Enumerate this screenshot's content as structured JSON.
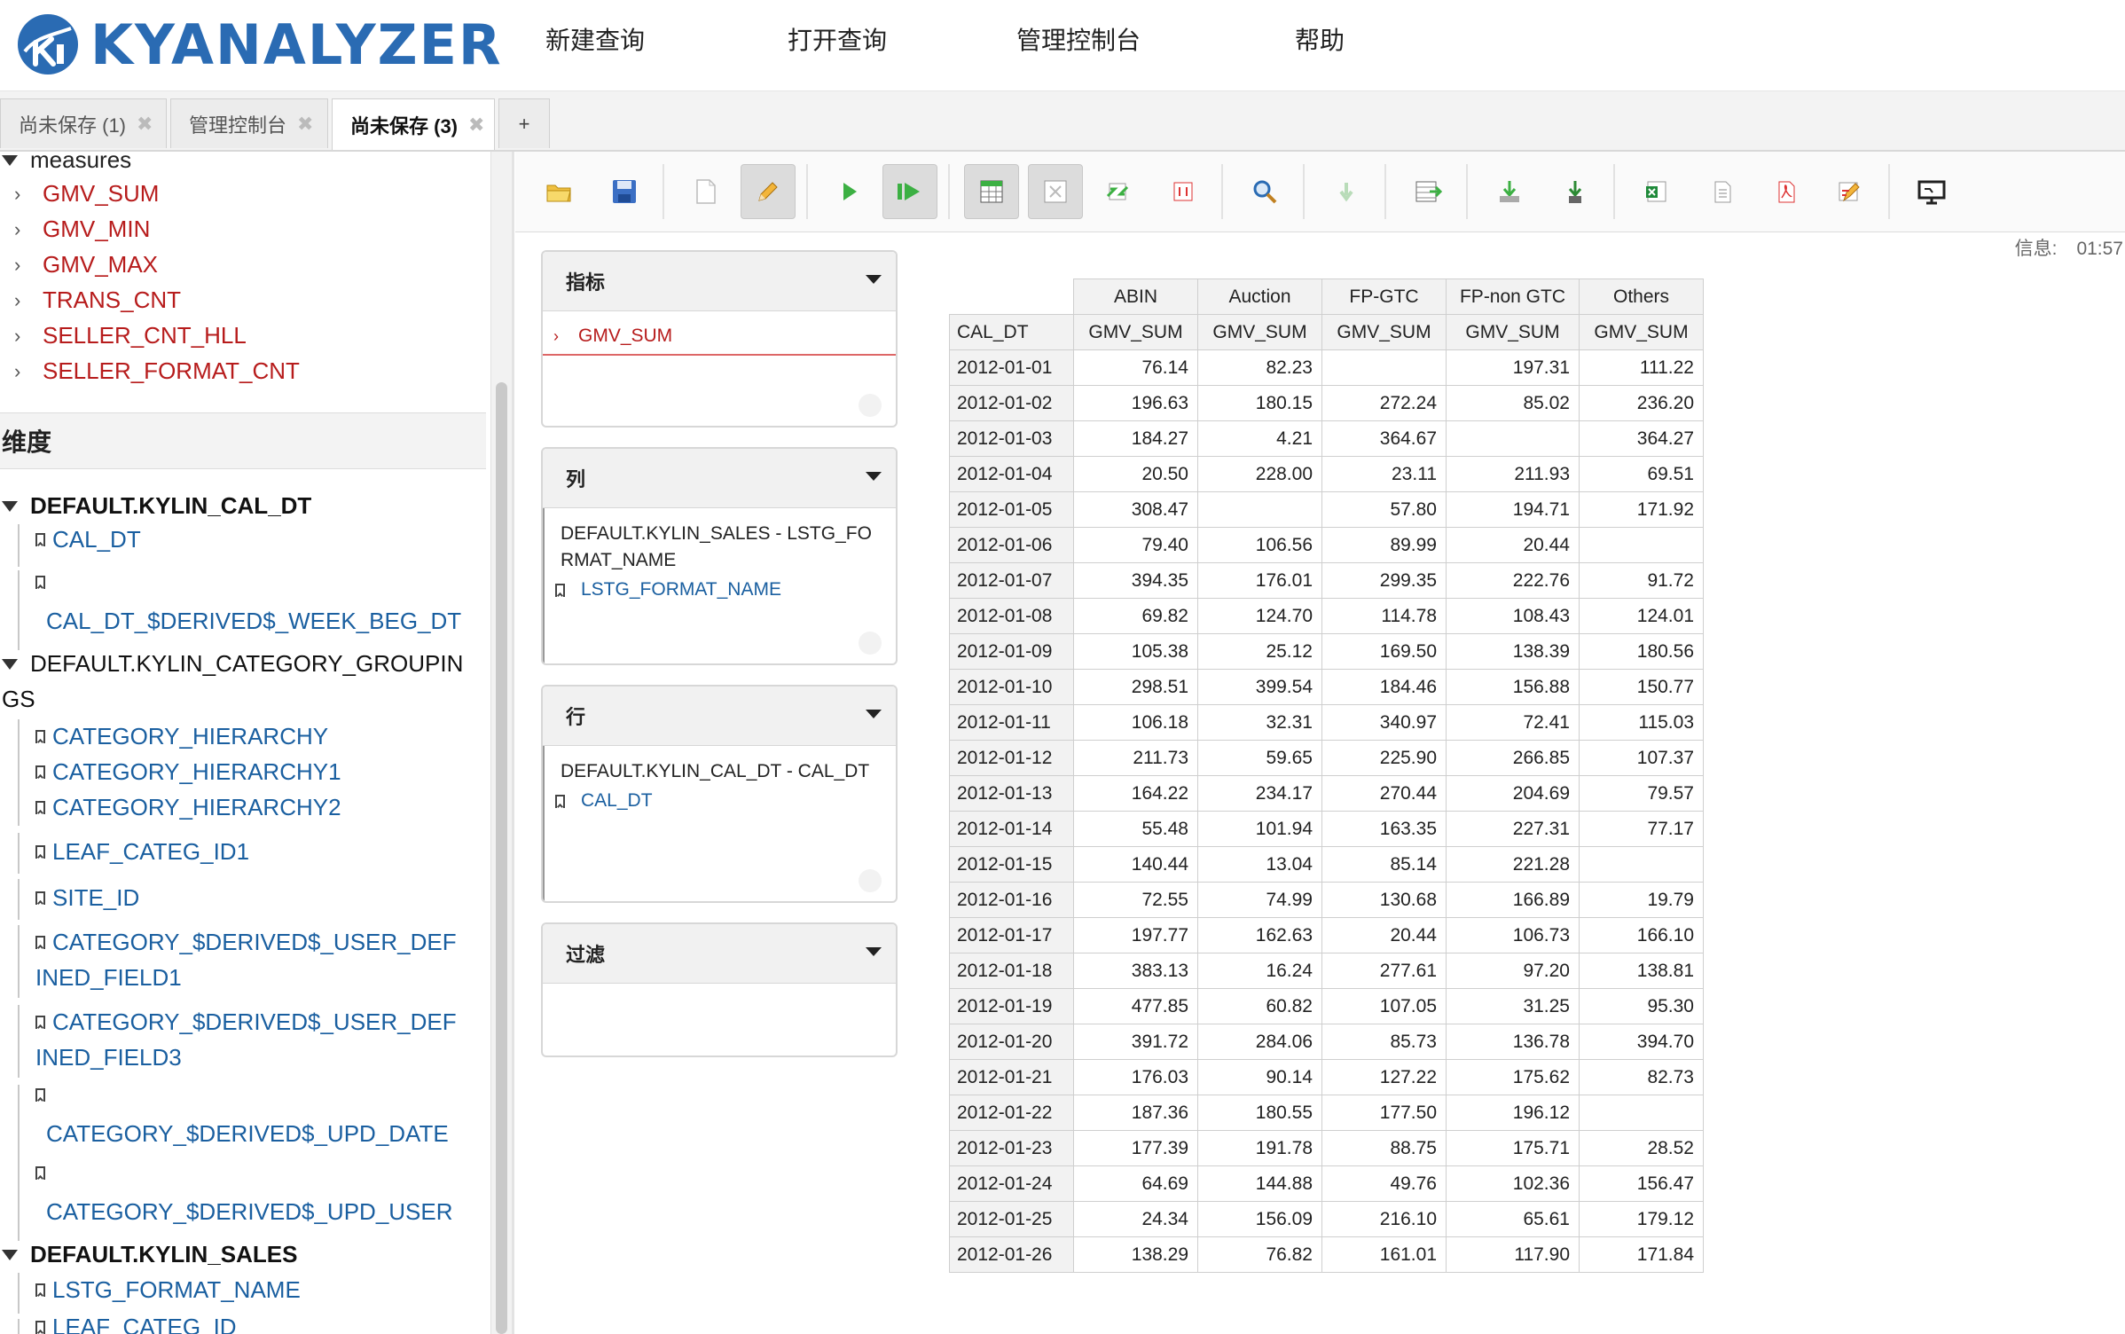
{
  "app": {
    "logo_text": "KYANALYZER",
    "menu": [
      "新建查询",
      "打开查询",
      "管理控制台",
      "帮助"
    ]
  },
  "tabs": [
    {
      "label": "尚未保存 (1)",
      "active": false
    },
    {
      "label": "管理控制台",
      "active": false
    },
    {
      "label": "尚未保存 (3)",
      "active": true
    }
  ],
  "tab_add": "+",
  "colors": {
    "accent": "#2a6bb3",
    "measure": "#b71c1c",
    "dimension": "#1a5fa0"
  },
  "tree": {
    "measures_label": "measures",
    "measures": [
      "GMV_SUM",
      "GMV_MIN",
      "GMV_MAX",
      "TRANS_CNT",
      "SELLER_CNT_HLL",
      "SELLER_FORMAT_CNT"
    ],
    "dimensions_label": "维度",
    "groups": [
      {
        "name": "DEFAULT.KYLIN_CAL_DT",
        "items": [
          "CAL_DT",
          "CAL_DT_$DERIVED$_WEEK_BEG_DT"
        ]
      },
      {
        "name_line1": "DEFAULT.KYLIN_CATEGORY_GROUPIN",
        "name_line2": "GS",
        "items": [
          "CATEGORY_HIERARCHY",
          "CATEGORY_HIERARCHY1",
          "CATEGORY_HIERARCHY2",
          "LEAF_CATEG_ID1",
          "SITE_ID"
        ],
        "wrapped": [
          {
            "line1": "CATEGORY_$DERIVED$_USER_DEF",
            "line2": "INED_FIELD1"
          },
          {
            "line1": "CATEGORY_$DERIVED$_USER_DEF",
            "line2": "INED_FIELD3"
          }
        ],
        "long_items": [
          "CATEGORY_$DERIVED$_UPD_DATE",
          "CATEGORY_$DERIVED$_UPD_USER"
        ]
      },
      {
        "name": "DEFAULT.KYLIN_SALES",
        "items": [
          "LSTG_FORMAT_NAME",
          "LEAF_CATEG_ID"
        ]
      }
    ]
  },
  "toolbar": {
    "icons": [
      "open-folder-icon",
      "save-icon",
      "new-icon",
      "edit-icon",
      "run-icon",
      "auto-run-icon",
      "table-view-icon",
      "hide-empty-icon",
      "swap-axes-icon",
      "mdx-icon",
      "zoom-icon",
      "drill-down-icon",
      "drill-across-icon",
      "export-icon",
      "export-alt-icon",
      "excel-icon",
      "csv-icon",
      "pdf-icon",
      "chart-edit-icon",
      "present-icon"
    ]
  },
  "info": {
    "label": "信息:",
    "value": "01:57"
  },
  "zones": {
    "measures": {
      "title": "指标",
      "item": "GMV_SUM"
    },
    "columns": {
      "title": "列",
      "group": "DEFAULT.KYLIN_SALES - LSTG_FORMAT_NAME",
      "item": "LSTG_FORMAT_NAME"
    },
    "rows": {
      "title": "行",
      "group": "DEFAULT.KYLIN_CAL_DT - CAL_DT",
      "item": "CAL_DT"
    },
    "filter": {
      "title": "过滤"
    }
  },
  "grid": {
    "row_header": "CAL_DT",
    "columns": [
      "ABIN",
      "Auction",
      "FP-GTC",
      "FP-non GTC",
      "Others"
    ],
    "measure_label": "GMV_SUM",
    "rows": [
      [
        "2012-01-01",
        "76.14",
        "82.23",
        "",
        "197.31",
        "111.22"
      ],
      [
        "2012-01-02",
        "196.63",
        "180.15",
        "272.24",
        "85.02",
        "236.20"
      ],
      [
        "2012-01-03",
        "184.27",
        "4.21",
        "364.67",
        "",
        "364.27"
      ],
      [
        "2012-01-04",
        "20.50",
        "228.00",
        "23.11",
        "211.93",
        "69.51"
      ],
      [
        "2012-01-05",
        "308.47",
        "",
        "57.80",
        "194.71",
        "171.92"
      ],
      [
        "2012-01-06",
        "79.40",
        "106.56",
        "89.99",
        "20.44",
        ""
      ],
      [
        "2012-01-07",
        "394.35",
        "176.01",
        "299.35",
        "222.76",
        "91.72"
      ],
      [
        "2012-01-08",
        "69.82",
        "124.70",
        "114.78",
        "108.43",
        "124.01"
      ],
      [
        "2012-01-09",
        "105.38",
        "25.12",
        "169.50",
        "138.39",
        "180.56"
      ],
      [
        "2012-01-10",
        "298.51",
        "399.54",
        "184.46",
        "156.88",
        "150.77"
      ],
      [
        "2012-01-11",
        "106.18",
        "32.31",
        "340.97",
        "72.41",
        "115.03"
      ],
      [
        "2012-01-12",
        "211.73",
        "59.65",
        "225.90",
        "266.85",
        "107.37"
      ],
      [
        "2012-01-13",
        "164.22",
        "234.17",
        "270.44",
        "204.69",
        "79.57"
      ],
      [
        "2012-01-14",
        "55.48",
        "101.94",
        "163.35",
        "227.31",
        "77.17"
      ],
      [
        "2012-01-15",
        "140.44",
        "13.04",
        "85.14",
        "221.28",
        ""
      ],
      [
        "2012-01-16",
        "72.55",
        "74.99",
        "130.68",
        "166.89",
        "19.79"
      ],
      [
        "2012-01-17",
        "197.77",
        "162.63",
        "20.44",
        "106.73",
        "166.10"
      ],
      [
        "2012-01-18",
        "383.13",
        "16.24",
        "277.61",
        "97.20",
        "138.81"
      ],
      [
        "2012-01-19",
        "477.85",
        "60.82",
        "107.05",
        "31.25",
        "95.30"
      ],
      [
        "2012-01-20",
        "391.72",
        "284.06",
        "85.73",
        "136.78",
        "394.70"
      ],
      [
        "2012-01-21",
        "176.03",
        "90.14",
        "127.22",
        "175.62",
        "82.73"
      ],
      [
        "2012-01-22",
        "187.36",
        "180.55",
        "177.50",
        "196.12",
        ""
      ],
      [
        "2012-01-23",
        "177.39",
        "191.78",
        "88.75",
        "175.71",
        "28.52"
      ],
      [
        "2012-01-24",
        "64.69",
        "144.88",
        "49.76",
        "102.36",
        "156.47"
      ],
      [
        "2012-01-25",
        "24.34",
        "156.09",
        "216.10",
        "65.61",
        "179.12"
      ],
      [
        "2012-01-26",
        "138.29",
        "76.82",
        "161.01",
        "117.90",
        "171.84"
      ]
    ]
  }
}
